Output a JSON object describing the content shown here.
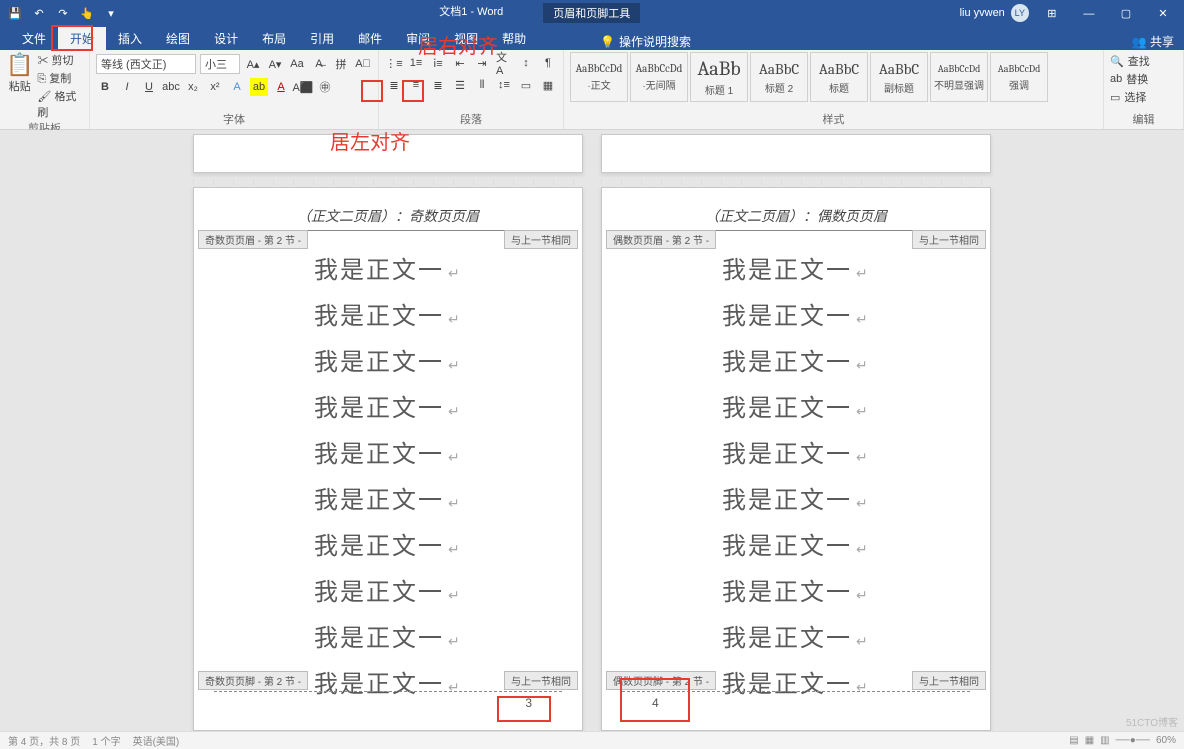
{
  "title": {
    "doc": "文档1 - Word",
    "context_tab": "页眉和页脚工具",
    "user": "liu yvwen",
    "avatar": "LY"
  },
  "qat": {
    "save": "💾",
    "undo": "↶",
    "redo": "↷",
    "touch": "👆",
    "more": "▾"
  },
  "win": {
    "ribbon_opts": "⊞",
    "min": "—",
    "max": "▢",
    "close": "✕"
  },
  "tabs": {
    "file": "文件",
    "home": "开始",
    "insert": "插入",
    "draw": "绘图",
    "design": "设计",
    "layout": "布局",
    "references": "引用",
    "mailings": "邮件",
    "review": "审阅",
    "view": "视图",
    "help": "帮助",
    "tell_me": "操作说明搜索",
    "share": "共享"
  },
  "ribbon": {
    "clipboard": {
      "label": "剪贴板",
      "paste": "粘贴",
      "cut": "剪切",
      "copy": "复制",
      "fmt_painter": "格式刷"
    },
    "font": {
      "label": "字体",
      "name": "等线 (西文正)",
      "size": "小三"
    },
    "paragraph": {
      "label": "段落"
    },
    "styles": {
      "label": "样式",
      "items": [
        {
          "preview": "AaBbCcDd",
          "name": "·正文"
        },
        {
          "preview": "AaBbCcDd",
          "name": "·无间隔"
        },
        {
          "preview": "AaBb",
          "name": "标题 1"
        },
        {
          "preview": "AaBbC",
          "name": "标题 2"
        },
        {
          "preview": "AaBbC",
          "name": "标题"
        },
        {
          "preview": "AaBbC",
          "name": "副标题"
        },
        {
          "preview": "AaBbCcDd",
          "name": "不明显强调"
        },
        {
          "preview": "AaBbCcDd",
          "name": "强调"
        }
      ]
    },
    "editing": {
      "label": "编辑",
      "find": "查找",
      "replace": "替换",
      "select": "选择"
    }
  },
  "annotations": {
    "align_right": "居右对齐",
    "align_left": "居左对齐"
  },
  "pages": {
    "left": {
      "header_text": "（正文二页眉）：奇数页页眉",
      "header_tag": "奇数页页眉 - 第 2 节 -",
      "same_prev": "与上一节相同",
      "footer_tag": "奇数页页脚 - 第 2 节 -",
      "page_num": "3"
    },
    "right": {
      "header_text": "（正文二页眉）：偶数页页眉",
      "header_tag": "偶数页页眉 - 第 2 节 -",
      "same_prev": "与上一节相同",
      "footer_tag": "偶数页页脚 - 第 2 节 -",
      "page_num": "4"
    },
    "body_line": "我是正文一",
    "lines_count": 10
  },
  "status": {
    "page": "第 4 页，共 8 页",
    "words": "1 个字",
    "lang": "英语(美国)",
    "zoom": "60%"
  },
  "watermark": "51CTO博客"
}
